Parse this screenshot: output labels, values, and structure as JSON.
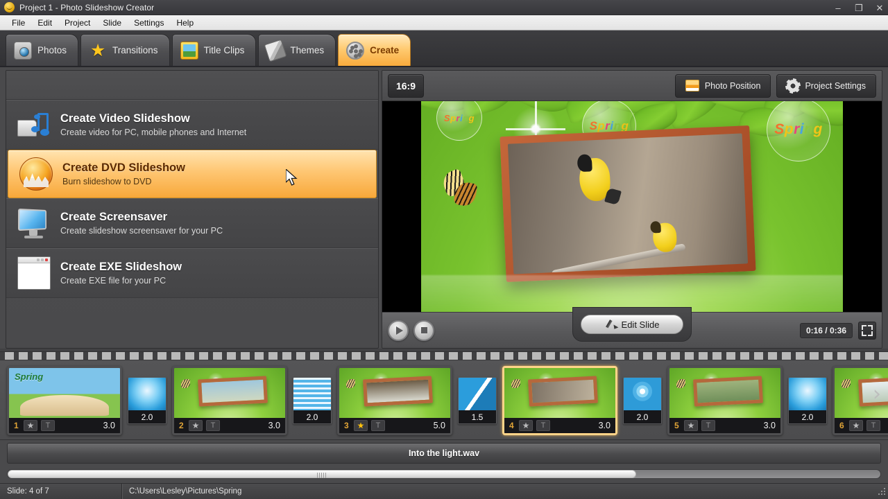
{
  "window": {
    "title": "Project 1 - Photo Slideshow Creator",
    "app_icon": "app-logo-icon",
    "minimize": "–",
    "maximize": "❐",
    "close": "✕"
  },
  "menubar": {
    "items": [
      "File",
      "Edit",
      "Project",
      "Slide",
      "Settings",
      "Help"
    ]
  },
  "tabs": [
    {
      "label": "Photos",
      "icon": "camera-icon",
      "active": false
    },
    {
      "label": "Transitions",
      "icon": "star-icon",
      "active": false
    },
    {
      "label": "Title Clips",
      "icon": "title-clip-icon",
      "active": false
    },
    {
      "label": "Themes",
      "icon": "brush-icon",
      "active": false
    },
    {
      "label": "Create",
      "icon": "film-reel-icon",
      "active": true
    }
  ],
  "create_options": [
    {
      "title": "Create Video Slideshow",
      "subtitle": "Create video for PC, mobile phones and Internet",
      "icon": "video-note-icon",
      "selected": false
    },
    {
      "title": "Create DVD Slideshow",
      "subtitle": "Burn slideshow to DVD",
      "icon": "dvd-burn-icon",
      "selected": true
    },
    {
      "title": "Create Screensaver",
      "subtitle": "Create slideshow screensaver for your PC",
      "icon": "monitor-icon",
      "selected": false
    },
    {
      "title": "Create EXE Slideshow",
      "subtitle": "Create EXE file for your PC",
      "icon": "exe-window-icon",
      "selected": false
    }
  ],
  "preview": {
    "aspect_ratio": "16:9",
    "photo_position_label": "Photo Position",
    "project_settings_label": "Project Settings",
    "edit_slide_label": "Edit Slide",
    "time_display": "0:16 / 0:36",
    "play_icon": "play-icon",
    "stop_icon": "stop-icon",
    "fullscreen_icon": "fullscreen-icon",
    "bubble_words": [
      "Spring",
      "Spring",
      "Spring"
    ]
  },
  "filmstrip": {
    "next_arrow": "›",
    "slides": [
      {
        "number": "1",
        "duration": "3.0",
        "starred": false,
        "title_marker": "T",
        "art": "th-book"
      },
      {
        "number": "2",
        "duration": "3.0",
        "starred": false,
        "title_marker": "T",
        "art": "mf-branch"
      },
      {
        "number": "3",
        "duration": "5.0",
        "starred": true,
        "title_marker": "T",
        "art": "mf-flowers"
      },
      {
        "number": "4",
        "duration": "3.0",
        "starred": false,
        "title_marker": "T",
        "art": "mf-birds"
      },
      {
        "number": "5",
        "duration": "3.0",
        "starred": false,
        "title_marker": "T",
        "art": "mf-lake"
      },
      {
        "number": "6",
        "duration": "",
        "starred": false,
        "title_marker": "T",
        "art": "mf-blossom"
      }
    ],
    "transitions": [
      {
        "duration": "2.0",
        "art": "tr-swirl"
      },
      {
        "duration": "2.0",
        "art": "tr-lines"
      },
      {
        "duration": "1.5",
        "art": "tr-wipe"
      },
      {
        "duration": "2.0",
        "art": "tr-ripple"
      },
      {
        "duration": "2.0",
        "art": "tr-swirl"
      }
    ]
  },
  "audio": {
    "track_name": "Into the light.wav"
  },
  "statusbar": {
    "slide_info": "Slide: 4 of 7",
    "folder_path": "C:\\Users\\Lesley\\Pictures\\Spring"
  },
  "colors": {
    "accent_orange": "#f9ab3c",
    "panel_gray": "#4a4a4c",
    "selected_border": "#ffd489"
  }
}
